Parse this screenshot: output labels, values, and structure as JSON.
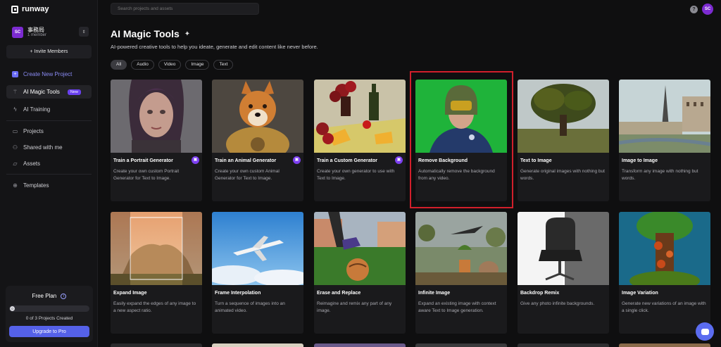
{
  "app": {
    "logo_text": "runway"
  },
  "team": {
    "avatar": "SC",
    "name": "事務局",
    "members": "1 member"
  },
  "sidebar": {
    "invite_label": "+ Invite Members",
    "create_label": "Create New Project",
    "items": [
      {
        "label": "AI Magic Tools",
        "badge": "New"
      },
      {
        "label": "AI Training"
      },
      {
        "label": "Projects"
      },
      {
        "label": "Shared with me"
      },
      {
        "label": "Assets"
      },
      {
        "label": "Templates"
      }
    ]
  },
  "plan": {
    "title": "Free Plan",
    "count": "0 of 3 Projects Created",
    "knob": "0",
    "progress": 0,
    "upgrade_label": "Upgrade to Pro"
  },
  "search": {
    "placeholder": "Search projects and assets"
  },
  "user": {
    "avatar": "SC"
  },
  "help_glyph": "?",
  "page": {
    "title": "AI Magic Tools",
    "subtitle": "AI-powered creative tools to help you ideate, generate and edit content like never before."
  },
  "filters": [
    "All",
    "Audio",
    "Video",
    "Image",
    "Text"
  ],
  "cards": [
    {
      "title": "Train a Portrait Generator",
      "desc": "Create your own custom Portrait Generator for Text to Image.",
      "locked": true
    },
    {
      "title": "Train an Animal Generator",
      "desc": "Create your own custom Animal Generator for Text to Image.",
      "locked": true
    },
    {
      "title": "Train a Custom Generator",
      "desc": "Create your own generator to use with Text to Image.",
      "locked": true
    },
    {
      "title": "Remove Background",
      "desc": "Automatically remove the background from any video.",
      "locked": false
    },
    {
      "title": "Text to Image",
      "desc": "Generate original images with nothing but words.",
      "locked": false
    },
    {
      "title": "Image to Image",
      "desc": "Transform any image with nothing but words.",
      "locked": false
    },
    {
      "title": "Expand Image",
      "desc": "Easily expand the edges of any image to a new aspect ratio.",
      "locked": false
    },
    {
      "title": "Frame Interpolation",
      "desc": "Turn a sequence of images into an animated video.",
      "locked": false
    },
    {
      "title": "Erase and Replace",
      "desc": "Reimagine and remix any part of any image.",
      "locked": false
    },
    {
      "title": "Infinite Image",
      "desc": "Expand an existing image with context aware Text to Image generation.",
      "locked": false
    },
    {
      "title": "Backdrop Remix",
      "desc": "Give any photo infinite backgrounds.",
      "locked": false
    },
    {
      "title": "Image Variation",
      "desc": "Generate new variations of an image with a single click.",
      "locked": false
    }
  ],
  "colors": {
    "accent": "#5561e8",
    "badge": "#6a41f0",
    "highlight": "#d11f2b",
    "avatar": "#7c2bd1"
  }
}
